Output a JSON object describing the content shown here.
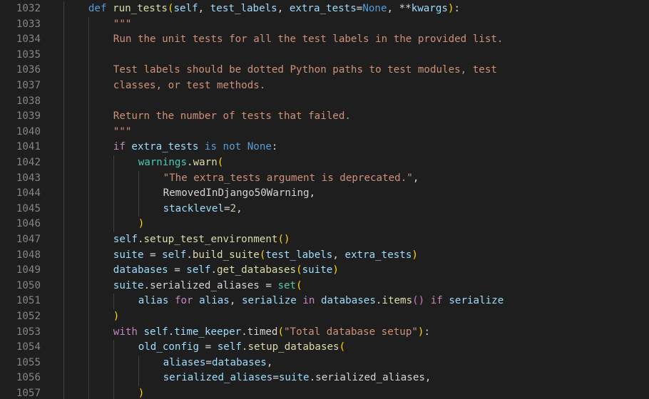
{
  "editor": {
    "language": "python",
    "colors": {
      "background": "#1e1e1e",
      "line_number": "#858585",
      "keyword": "#569cd6",
      "control": "#c586c0",
      "function": "#dcdcaa",
      "variable": "#9cdcfe",
      "string": "#ce9178",
      "number": "#b5cea8",
      "bracket1": "#ffd700",
      "bracket2": "#da70d6"
    },
    "lines": [
      {
        "number": "1032",
        "indent": 1,
        "tokens": [
          [
            "kw",
            "def "
          ],
          [
            "fn",
            "run_tests"
          ],
          [
            "br1",
            "("
          ],
          [
            "var",
            "self"
          ],
          [
            "plain",
            ", "
          ],
          [
            "var",
            "test_labels"
          ],
          [
            "plain",
            ", "
          ],
          [
            "var",
            "extra_tests"
          ],
          [
            "plain",
            "="
          ],
          [
            "kw",
            "None"
          ],
          [
            "plain",
            ", "
          ],
          [
            "plain",
            "**"
          ],
          [
            "var",
            "kwargs"
          ],
          [
            "br1",
            ")"
          ],
          [
            "plain",
            ":"
          ]
        ]
      },
      {
        "number": "1033",
        "indent": 2,
        "tokens": [
          [
            "str",
            "\"\"\""
          ]
        ]
      },
      {
        "number": "1034",
        "indent": 2,
        "tokens": [
          [
            "str",
            "Run the unit tests for all the test labels in the provided list."
          ]
        ]
      },
      {
        "number": "1035",
        "indent": 2,
        "tokens": []
      },
      {
        "number": "1036",
        "indent": 2,
        "tokens": [
          [
            "str",
            "Test labels should be dotted Python paths to test modules, test"
          ]
        ]
      },
      {
        "number": "1037",
        "indent": 2,
        "tokens": [
          [
            "str",
            "classes, or test methods."
          ]
        ]
      },
      {
        "number": "1038",
        "indent": 2,
        "tokens": []
      },
      {
        "number": "1039",
        "indent": 2,
        "tokens": [
          [
            "str",
            "Return the number of tests that failed."
          ]
        ]
      },
      {
        "number": "1040",
        "indent": 2,
        "tokens": [
          [
            "str",
            "\"\"\""
          ]
        ]
      },
      {
        "number": "1041",
        "indent": 2,
        "tokens": [
          [
            "ctl",
            "if "
          ],
          [
            "var",
            "extra_tests"
          ],
          [
            "kw",
            " is not "
          ],
          [
            "kw",
            "None"
          ],
          [
            "plain",
            ":"
          ]
        ]
      },
      {
        "number": "1042",
        "indent": 3,
        "tokens": [
          [
            "cls",
            "warnings"
          ],
          [
            "plain",
            "."
          ],
          [
            "fn",
            "warn"
          ],
          [
            "br1",
            "("
          ]
        ]
      },
      {
        "number": "1043",
        "indent": 4,
        "tokens": [
          [
            "str",
            "\"The extra_tests argument is deprecated.\""
          ],
          [
            "plain",
            ","
          ]
        ]
      },
      {
        "number": "1044",
        "indent": 4,
        "tokens": [
          [
            "plain",
            "RemovedInDjango50Warning,"
          ]
        ]
      },
      {
        "number": "1045",
        "indent": 4,
        "tokens": [
          [
            "var",
            "stacklevel"
          ],
          [
            "plain",
            "="
          ],
          [
            "num",
            "2"
          ],
          [
            "plain",
            ","
          ]
        ]
      },
      {
        "number": "1046",
        "indent": 3,
        "tokens": [
          [
            "br1",
            ")"
          ]
        ]
      },
      {
        "number": "1047",
        "indent": 2,
        "tokens": [
          [
            "var",
            "self"
          ],
          [
            "plain",
            "."
          ],
          [
            "fn",
            "setup_test_environment"
          ],
          [
            "br1",
            "()"
          ]
        ]
      },
      {
        "number": "1048",
        "indent": 2,
        "tokens": [
          [
            "var",
            "suite"
          ],
          [
            "plain",
            " = "
          ],
          [
            "var",
            "self"
          ],
          [
            "plain",
            "."
          ],
          [
            "fn",
            "build_suite"
          ],
          [
            "br1",
            "("
          ],
          [
            "var",
            "test_labels"
          ],
          [
            "plain",
            ", "
          ],
          [
            "var",
            "extra_tests"
          ],
          [
            "br1",
            ")"
          ]
        ]
      },
      {
        "number": "1049",
        "indent": 2,
        "tokens": [
          [
            "var",
            "databases"
          ],
          [
            "plain",
            " = "
          ],
          [
            "var",
            "self"
          ],
          [
            "plain",
            "."
          ],
          [
            "fn",
            "get_databases"
          ],
          [
            "br1",
            "("
          ],
          [
            "var",
            "suite"
          ],
          [
            "br1",
            ")"
          ]
        ]
      },
      {
        "number": "1050",
        "indent": 2,
        "tokens": [
          [
            "var",
            "suite"
          ],
          [
            "plain",
            "."
          ],
          [
            "plain",
            "serialized_aliases = "
          ],
          [
            "cls",
            "set"
          ],
          [
            "br1",
            "("
          ]
        ]
      },
      {
        "number": "1051",
        "indent": 3,
        "tokens": [
          [
            "var",
            "alias"
          ],
          [
            "ctl",
            " for "
          ],
          [
            "var",
            "alias"
          ],
          [
            "plain",
            ", "
          ],
          [
            "var",
            "serialize"
          ],
          [
            "ctl",
            " in "
          ],
          [
            "var",
            "databases"
          ],
          [
            "plain",
            "."
          ],
          [
            "fn",
            "items"
          ],
          [
            "br2",
            "()"
          ],
          [
            "ctl",
            " if "
          ],
          [
            "var",
            "serialize"
          ]
        ]
      },
      {
        "number": "1052",
        "indent": 2,
        "tokens": [
          [
            "br1",
            ")"
          ]
        ]
      },
      {
        "number": "1053",
        "indent": 2,
        "tokens": [
          [
            "ctl",
            "with "
          ],
          [
            "var",
            "self"
          ],
          [
            "plain",
            "."
          ],
          [
            "var",
            "time_keeper"
          ],
          [
            "plain",
            ".timed"
          ],
          [
            "br1",
            "("
          ],
          [
            "str",
            "\"Total database setup\""
          ],
          [
            "br1",
            ")"
          ],
          [
            "plain",
            ":"
          ]
        ]
      },
      {
        "number": "1054",
        "indent": 3,
        "tokens": [
          [
            "var",
            "old_config"
          ],
          [
            "plain",
            " = "
          ],
          [
            "var",
            "self"
          ],
          [
            "plain",
            "."
          ],
          [
            "fn",
            "setup_databases"
          ],
          [
            "br1",
            "("
          ]
        ]
      },
      {
        "number": "1055",
        "indent": 4,
        "tokens": [
          [
            "var",
            "aliases"
          ],
          [
            "plain",
            "="
          ],
          [
            "var",
            "databases"
          ],
          [
            "plain",
            ","
          ]
        ]
      },
      {
        "number": "1056",
        "indent": 4,
        "tokens": [
          [
            "var",
            "serialized_aliases"
          ],
          [
            "plain",
            "="
          ],
          [
            "var",
            "suite"
          ],
          [
            "plain",
            ".serialized_aliases,"
          ]
        ]
      },
      {
        "number": "1057",
        "indent": 3,
        "tokens": [
          [
            "br1",
            ")"
          ]
        ]
      }
    ]
  }
}
